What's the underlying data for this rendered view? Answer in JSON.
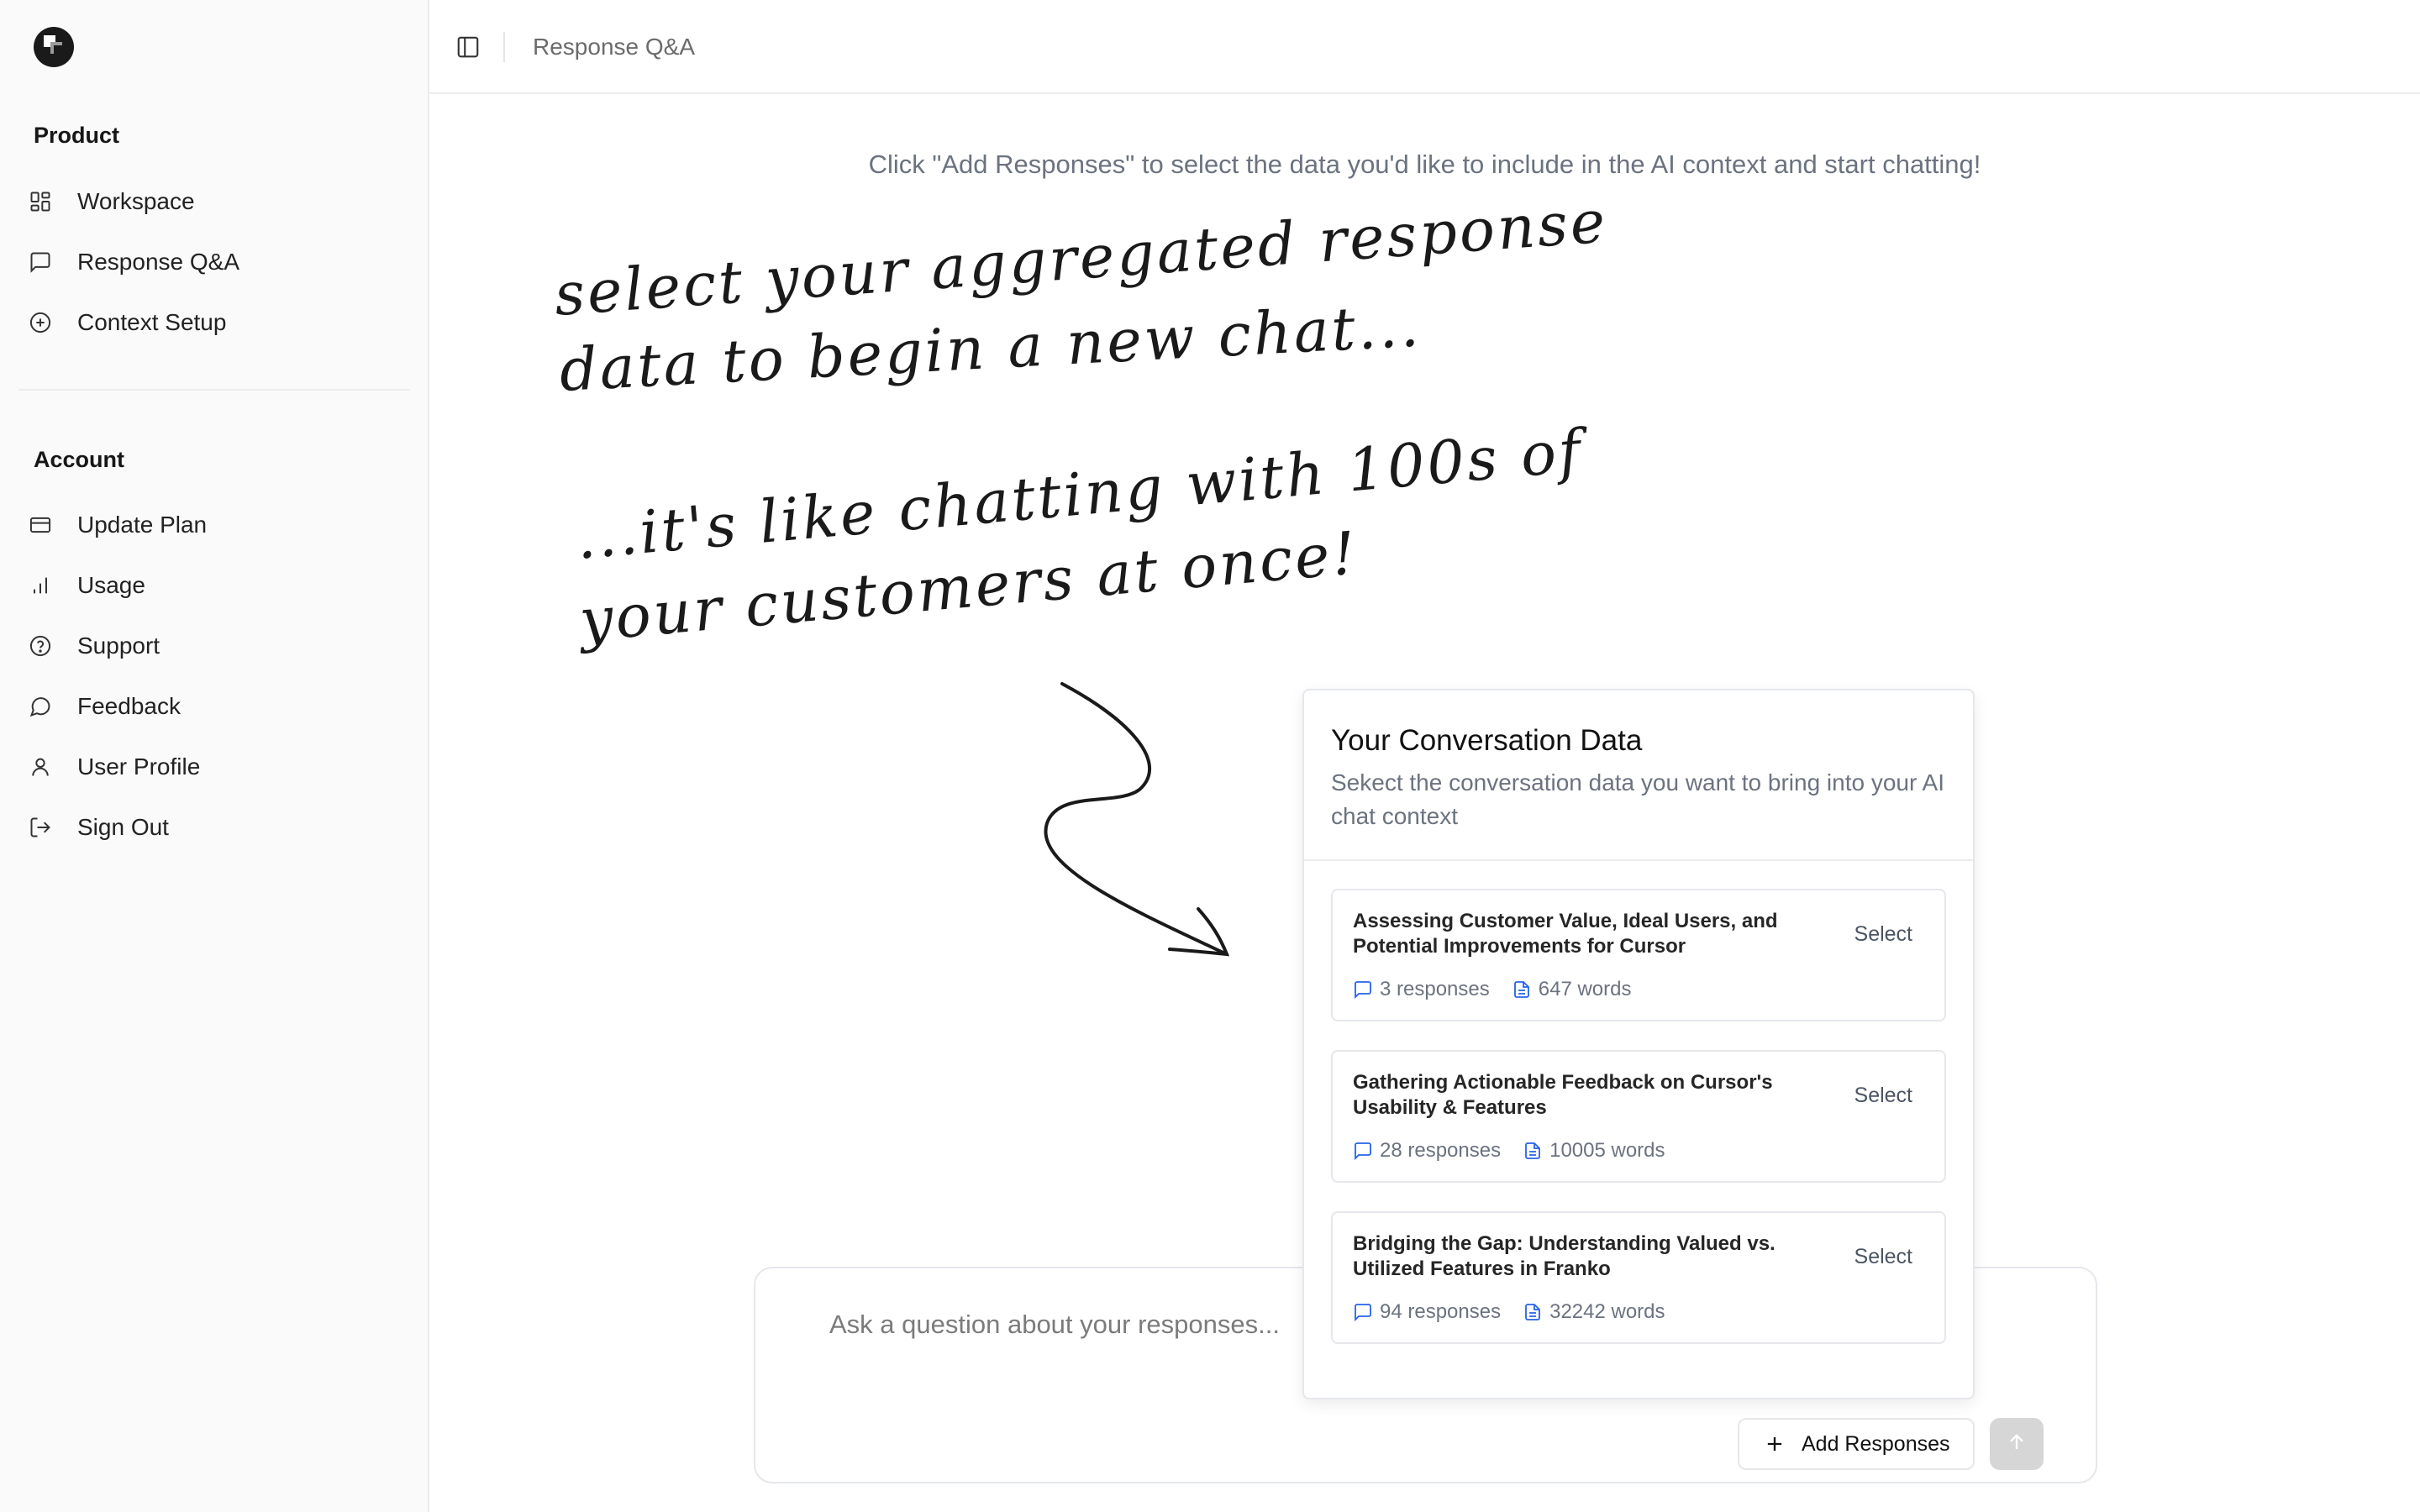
{
  "sidebar": {
    "sections": [
      {
        "title": "Product"
      },
      {
        "title": "Account"
      }
    ],
    "product_items": [
      {
        "label": "Workspace",
        "icon": "grid-icon"
      },
      {
        "label": "Response Q&A",
        "icon": "message-square-icon"
      },
      {
        "label": "Context Setup",
        "icon": "plus-circle-icon"
      }
    ],
    "account_items": [
      {
        "label": "Update Plan",
        "icon": "credit-card-icon"
      },
      {
        "label": "Usage",
        "icon": "bar-chart-icon"
      },
      {
        "label": "Support",
        "icon": "help-circle-icon"
      },
      {
        "label": "Feedback",
        "icon": "message-circle-icon"
      },
      {
        "label": "User Profile",
        "icon": "user-icon"
      },
      {
        "label": "Sign Out",
        "icon": "log-out-icon"
      }
    ]
  },
  "header": {
    "breadcrumb": "Response Q&A"
  },
  "main": {
    "hint": "Click \"Add Responses\" to select the data you'd like to include in the AI context and start chatting!",
    "handwriting": [
      "select your aggregated response",
      "data to begin a new chat...",
      "...it's like chatting with 100s of",
      "your customers at once!"
    ]
  },
  "chat": {
    "placeholder": "Ask a question about your responses...",
    "add_label": "Add Responses"
  },
  "popup": {
    "title": "Your Conversation Data",
    "subtitle": "Sekect the conversation data you want to bring into your AI chat context",
    "items": [
      {
        "title": "Assessing Customer Value, Ideal Users, and Potential Improvements for Cursor",
        "responses": "3 responses",
        "words": "647 words",
        "action": "Select"
      },
      {
        "title": "Gathering Actionable Feedback on Cursor's Usability & Features",
        "responses": "28 responses",
        "words": "10005 words",
        "action": "Select"
      },
      {
        "title": "Bridging the Gap: Understanding Valued vs. Utilized Features in Franko",
        "responses": "94 responses",
        "words": "32242 words",
        "action": "Select"
      }
    ]
  },
  "colors": {
    "accent_blue": "#2563eb",
    "border": "#e5e7eb",
    "muted_text": "#6b7280"
  }
}
